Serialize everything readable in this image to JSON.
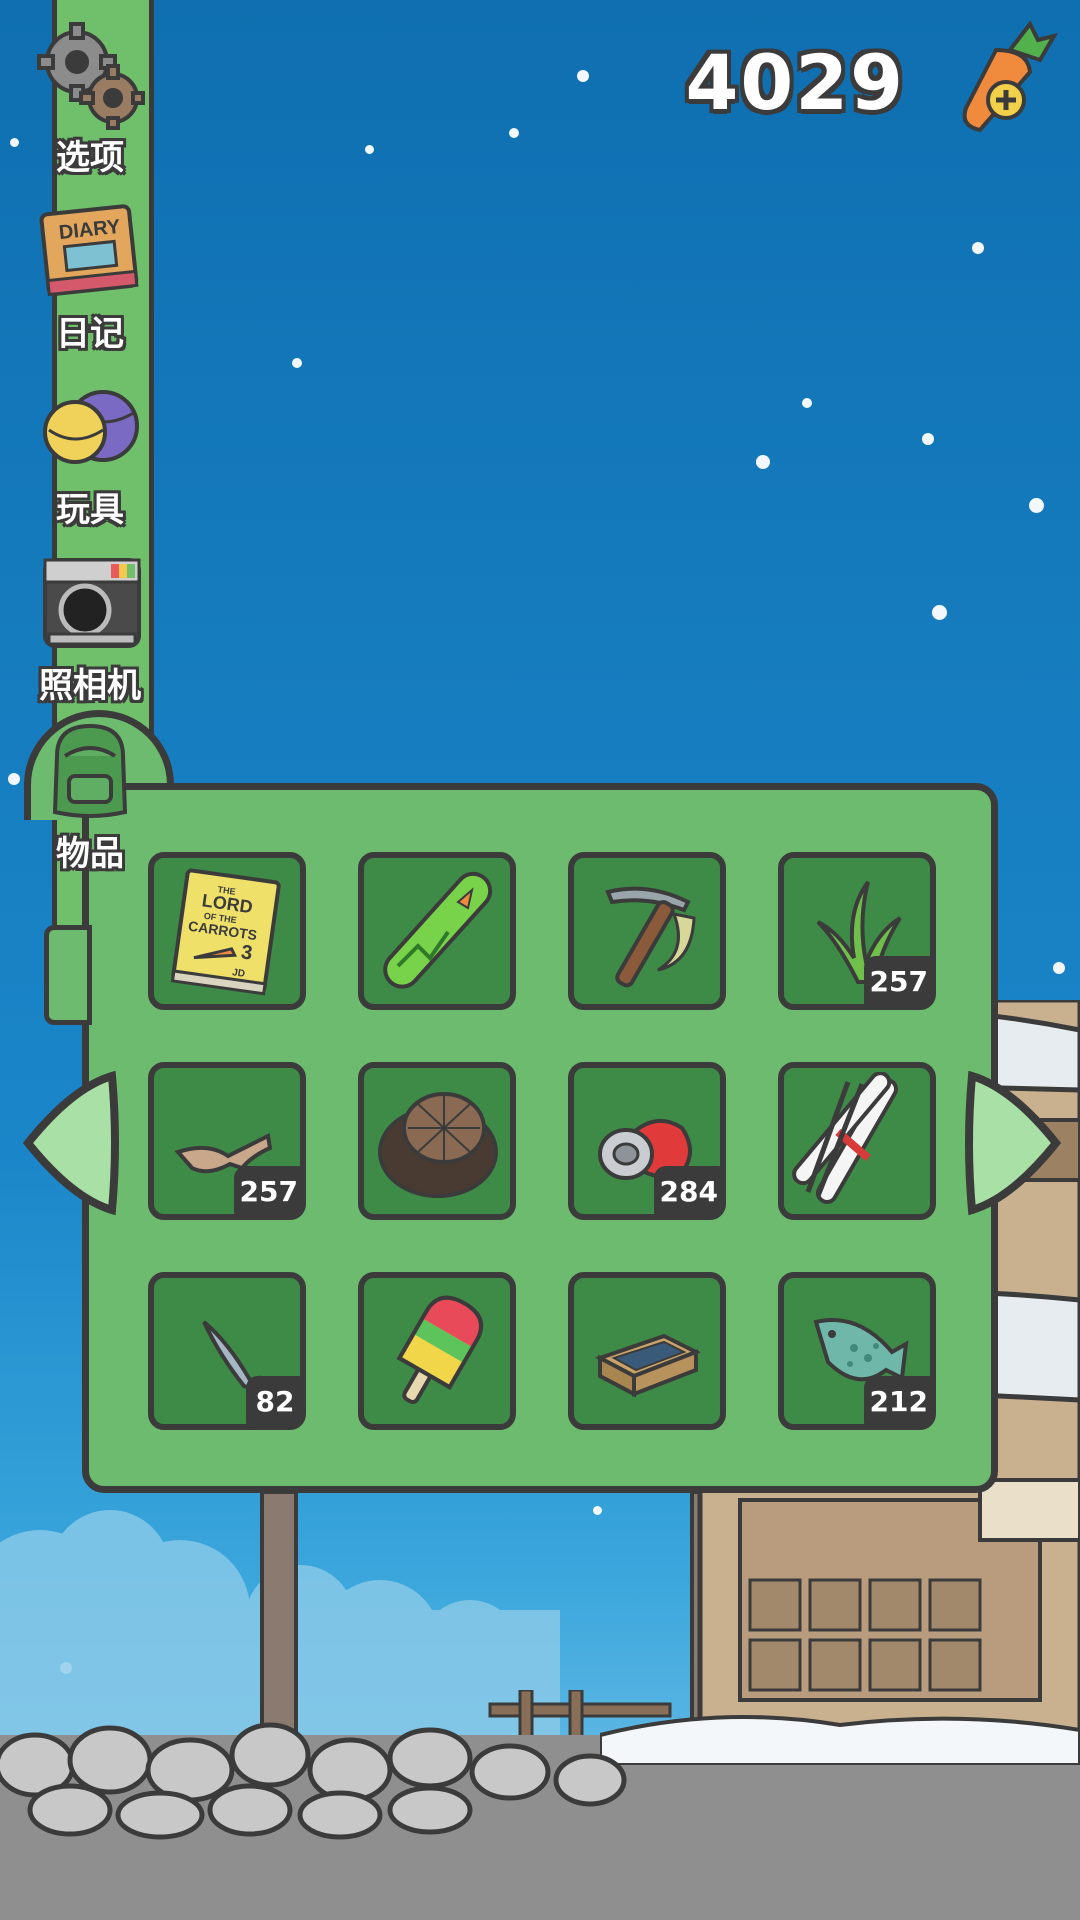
{
  "currency": {
    "carrots": "4029",
    "add_icon": "carrot-plus-icon"
  },
  "menu": [
    {
      "id": "options",
      "label": "选项",
      "icon": "gears-icon"
    },
    {
      "id": "diary",
      "label": "日记",
      "icon": "diary-icon"
    },
    {
      "id": "toys",
      "label": "玩具",
      "icon": "toy-balls-icon"
    },
    {
      "id": "camera",
      "label": "照相机",
      "icon": "camera-icon"
    },
    {
      "id": "items",
      "label": "物品",
      "icon": "backpack-icon"
    }
  ],
  "items": [
    {
      "name": "lord-of-the-carrots-book",
      "count": ""
    },
    {
      "name": "snowboard",
      "count": ""
    },
    {
      "name": "ice-axe",
      "count": ""
    },
    {
      "name": "seaweed",
      "count": "257"
    },
    {
      "name": "driftwood",
      "count": "257"
    },
    {
      "name": "straw-hat",
      "count": ""
    },
    {
      "name": "crushed-can",
      "count": "284"
    },
    {
      "name": "skis",
      "count": ""
    },
    {
      "name": "small-fish",
      "count": "82"
    },
    {
      "name": "popsicle",
      "count": ""
    },
    {
      "name": "matchbox",
      "count": ""
    },
    {
      "name": "big-fish",
      "count": "212"
    }
  ],
  "book_cover": {
    "line1": "THE",
    "line2": "LORD",
    "line3": "OF THE",
    "line4": "CARROTS",
    "volume": "3",
    "author": "JD"
  },
  "diary_cover": "DIARY",
  "colors": {
    "panel": "#6cbb6e",
    "slot": "#3e8a47",
    "outline": "#3b3b3b",
    "sky": "#1a86c9"
  }
}
